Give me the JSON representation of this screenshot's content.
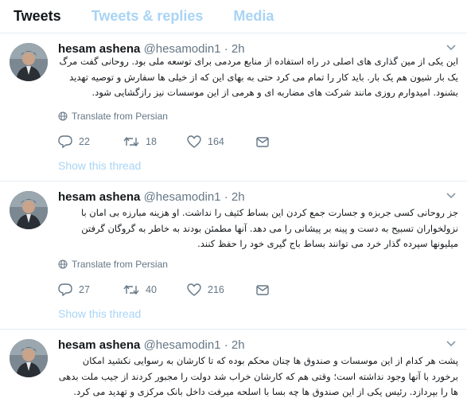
{
  "tabs": [
    "Tweets",
    "Tweets & replies",
    "Media"
  ],
  "tweets": [
    {
      "name": "hesam ashena",
      "handle": "@hesamodin1",
      "separator": "·",
      "time": "2h",
      "text": "این یکی از مین گذاری های اصلی در راه استفاده از منابع مردمی برای توسعه ملی بود. روحانی گفت مرگ یک بار شیون هم یک بار. باید کار را تمام می کرد حتی به بهای این که از خیلی ها سفارش و توصیه تهدید بشنود. امیدوارم روزی مانند شرکت های مضاربه ای و هرمی از این موسسات نیز رازگشایی شود.",
      "translate": "Translate from Persian",
      "replies": "22",
      "retweets": "18",
      "likes": "164",
      "show_thread": "Show this thread"
    },
    {
      "name": "hesam ashena",
      "handle": "@hesamodin1",
      "separator": "·",
      "time": "2h",
      "text": "جز روحانی کسی جربزه و جسارت جمع کردن این بساط کثیف را نداشت. او هزینه مبارزه بی امان با نزولخواران تسبیح به دست و پینه بر پیشانی را می دهد. آنها مطمئن بودند به خاطر به گروگان گرفتن میلیونها سپرده گذار خرد می توانند بساط باج گیری خود را حفظ کنند.",
      "translate": "Translate from Persian",
      "replies": "27",
      "retweets": "40",
      "likes": "216",
      "show_thread": "Show this thread"
    },
    {
      "name": "hesam ashena",
      "handle": "@hesamodin1",
      "separator": "·",
      "time": "2h",
      "text": "پشت هر کدام از این موسسات و صندوق ها چنان محکم بوده که تا کارشان به رسوایی نکشید امکان برخورد با آنها وجود نداشته است؛ وقتی هم که کارشان خراب شد دولت را مجبور کردند از جیب ملت بدهی ها را بپردازد. رئیس یکی از این صندوق ها چه بسا با اسلحه میرفت داخل بانک مرکزی و تهدید می کرد."
    }
  ],
  "icons": {
    "reply": "reply-icon",
    "retweet": "retweet-icon",
    "like": "heart-icon",
    "dm": "envelope-icon",
    "globe": "globe-icon",
    "caret": "chevron-down-icon"
  },
  "colors": {
    "text": "#14171a",
    "secondary": "#657786",
    "link_faded": "#a8d4f5",
    "divider": "#e6ecf0"
  }
}
